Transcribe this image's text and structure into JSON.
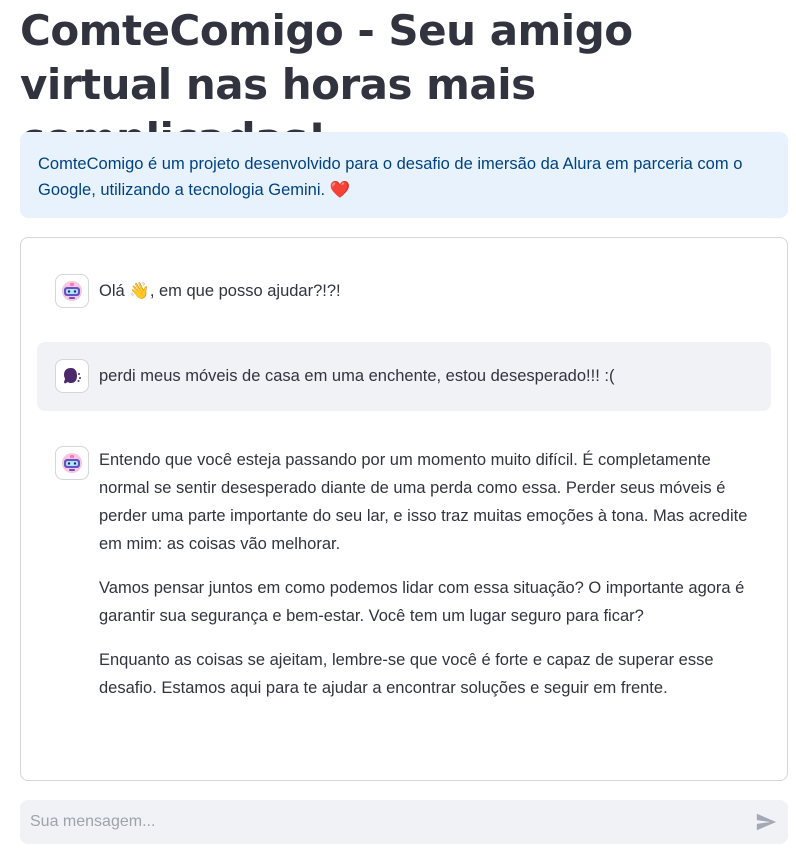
{
  "header": {
    "title": "ComteComigo - Seu amigo virtual nas horas mais complicadas!"
  },
  "info": {
    "text": "ComteComigo é um projeto desenvolvido para o desafio de imersão da Alura em parceria com o Google, utilizando a tecnologia Gemini.",
    "emoji": "❤️"
  },
  "chat": {
    "messages": [
      {
        "role": "assistant",
        "avatar_icon": "robot-icon",
        "text_before": "Olá",
        "emoji": "👋",
        "text_after": ", em que posso ajudar?!?!"
      },
      {
        "role": "user",
        "avatar_icon": "user-speaking-icon",
        "text": "perdi meus móveis de casa em uma enchente, estou desesperado!!! :("
      },
      {
        "role": "assistant",
        "avatar_icon": "robot-icon",
        "paragraphs": [
          "Entendo que você esteja passando por um momento muito difícil. É completamente normal se sentir desesperado diante de uma perda como essa. Perder seus móveis é perder uma parte importante do seu lar, e isso traz muitas emoções à tona. Mas acredite em mim: as coisas vão melhorar.",
          "Vamos pensar juntos em como podemos lidar com essa situação? O importante agora é garantir sua segurança e bem-estar. Você tem um lugar seguro para ficar?",
          "Enquanto as coisas se ajeitam, lembre-se que você é forte e capaz de superar esse desafio. Estamos aqui para te ajudar a encontrar soluções e seguir em frente."
        ]
      }
    ]
  },
  "input": {
    "placeholder": "Sua mensagem...",
    "value": "",
    "send_icon": "send-icon"
  },
  "colors": {
    "info_bg": "#e8f2fd",
    "info_text": "#004280",
    "user_bubble_bg": "#f0f2f6",
    "text": "#31333f",
    "input_bg": "#f0f2f6",
    "user_avatar": "#4a2a6b"
  }
}
